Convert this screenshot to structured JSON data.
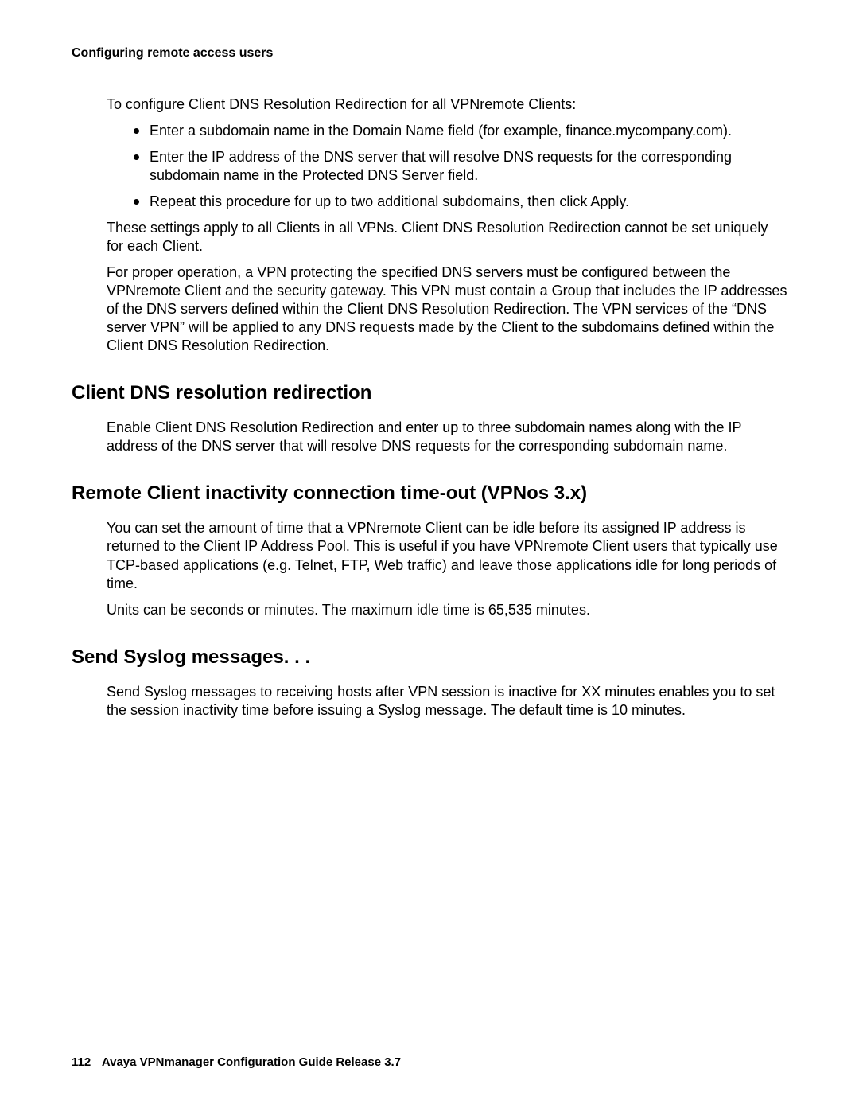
{
  "header": {
    "running_title": "Configuring remote access users"
  },
  "intro": {
    "p1": "To configure Client DNS Resolution Redirection for all VPNremote Clients:",
    "bullets": [
      "Enter a subdomain name in the Domain Name field (for example, finance.mycompany.com).",
      "Enter the IP address of the DNS server that will resolve DNS requests for the corresponding subdomain name in the Protected DNS Server field.",
      "Repeat this procedure for up to two additional subdomains, then click Apply."
    ],
    "p2": "These settings apply to all Clients in all VPNs. Client DNS Resolution Redirection cannot be set uniquely for each Client.",
    "p3": "For proper operation, a VPN protecting the specified DNS servers must be configured between the VPNremote Client and the security gateway. This VPN must contain a Group that includes the IP addresses of the DNS servers defined within the Client DNS Resolution Redirection. The VPN services of the “DNS server VPN” will be applied to any DNS requests made by the Client to the subdomains defined within the Client DNS Resolution Redirection."
  },
  "sections": {
    "s1": {
      "title": "Client DNS resolution redirection",
      "p1": "Enable Client DNS Resolution Redirection and enter up to three subdomain names along with the IP address of the DNS server that will resolve DNS requests for the corresponding subdomain name."
    },
    "s2": {
      "title": "Remote Client inactivity connection time-out (VPNos 3.x)",
      "p1": "You can set the amount of time that a VPNremote Client can be idle before its assigned IP address is returned to the Client IP Address Pool. This is useful if you have VPNremote Client users that typically use TCP-based applications (e.g. Telnet, FTP, Web traffic) and leave those applications idle for long periods of time.",
      "p2": "Units can be seconds or minutes. The maximum idle time is 65,535 minutes."
    },
    "s3": {
      "title": "Send Syslog messages. . .",
      "p1": "Send Syslog messages to receiving hosts after VPN session is inactive for XX minutes enables you to set the session inactivity time before issuing a Syslog message. The default time is 10 minutes."
    }
  },
  "footer": {
    "page_number": "112",
    "doc_title": "Avaya VPNmanager Configuration Guide Release 3.7"
  }
}
